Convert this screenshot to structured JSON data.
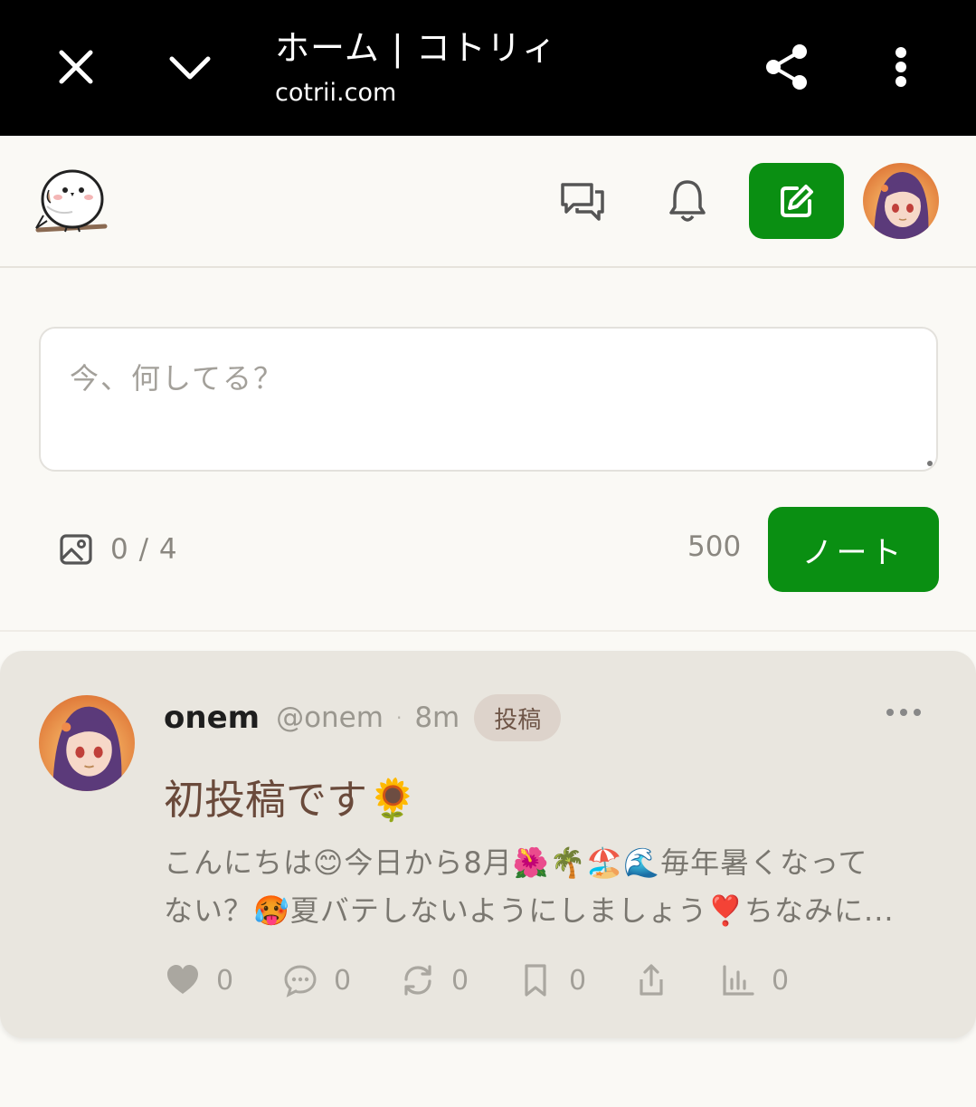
{
  "browser": {
    "title": "ホーム | コトリィ",
    "url": "cotrii.com"
  },
  "composer": {
    "placeholder": "今、何してる？",
    "media_count": "0 / 4",
    "char_remaining": "500",
    "submit_label": "ノート"
  },
  "post": {
    "display_name": "onem",
    "handle": "@onem",
    "separator": "·",
    "time": "8m",
    "badge": "投稿",
    "title": "初投稿です🌻",
    "body_line1": "こんにちは😊今日から8月🌺🌴🏖️🌊毎年暑くなって",
    "body_line2": "ない？🥵夏バテしないようにしましょう❣️ちなみに...",
    "counts": {
      "likes": "0",
      "replies": "0",
      "renotes": "0",
      "bookmarks": "0",
      "views": "0"
    }
  },
  "colors": {
    "accent": "#0a8f12",
    "page_bg": "#faf9f5",
    "card_bg": "#e9e6df",
    "title_brown": "#6a4a3b"
  },
  "icons": [
    "close-icon",
    "chevron-down-icon",
    "share-icon",
    "more-vertical-icon",
    "chat-bubbles-icon",
    "bell-icon",
    "edit-icon",
    "image-icon",
    "more-horizontal-icon",
    "heart-icon",
    "comment-icon",
    "repost-icon",
    "bookmark-icon",
    "share-out-icon",
    "chart-icon"
  ]
}
